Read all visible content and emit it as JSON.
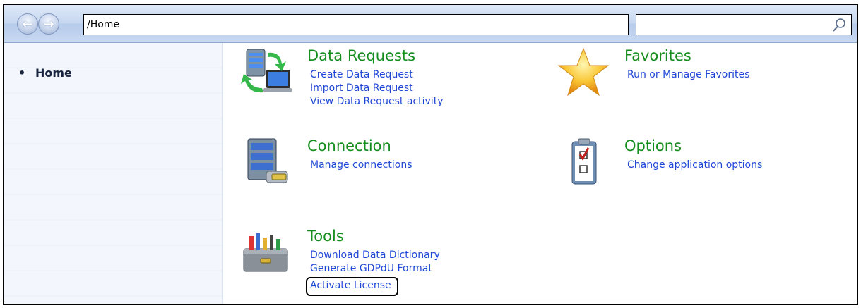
{
  "toolbar": {
    "back_icon": "arrow-left-icon",
    "forward_icon": "arrow-right-icon",
    "address_value": "/Home",
    "search_value": "",
    "search_icon": "magnifier-icon"
  },
  "sidebar": {
    "items": [
      {
        "label": "Home"
      }
    ]
  },
  "groups": [
    {
      "title": "Data Requests",
      "icon": "data-request-sync-icon",
      "links": [
        "Create Data Request",
        "Import Data Request",
        "View Data Request activity"
      ]
    },
    {
      "title": "Favorites",
      "icon": "star-icon",
      "links": [
        "Run or Manage Favorites"
      ]
    },
    {
      "title": "Connection",
      "icon": "server-connection-icon",
      "links": [
        "Manage connections"
      ]
    },
    {
      "title": "Options",
      "icon": "clipboard-checklist-icon",
      "links": [
        "Change application options"
      ]
    },
    {
      "title": "Tools",
      "icon": "toolbox-icon",
      "links": [
        "Download Data Dictionary",
        "Generate GDPdU Format",
        "Activate License"
      ]
    }
  ],
  "colors": {
    "group_title": "#168e1f",
    "link": "#1f47d6",
    "highlight_box": "#000000"
  }
}
